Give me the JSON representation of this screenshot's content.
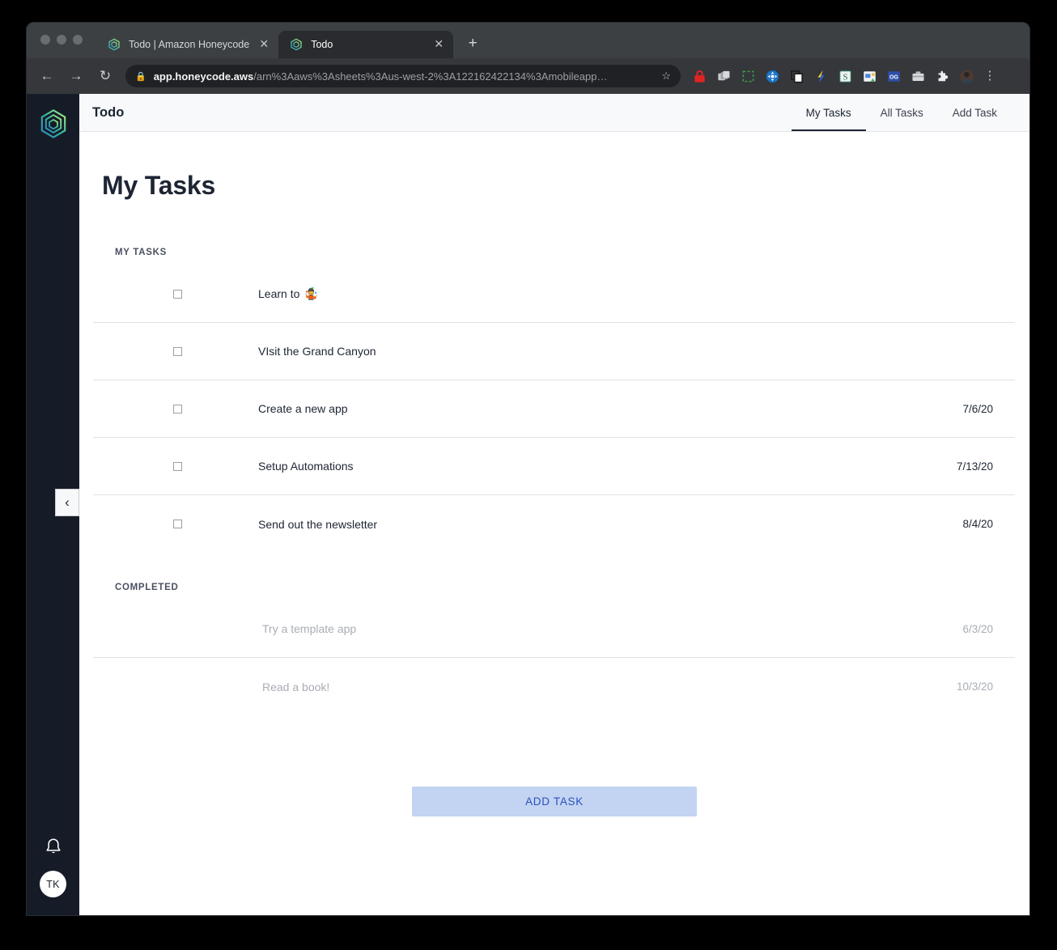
{
  "browser": {
    "tabs": [
      {
        "title": "Todo | Amazon Honeycode",
        "active": false,
        "favicon": "honeycode-icon",
        "close_label": "✕"
      },
      {
        "title": "Todo",
        "active": true,
        "favicon": "honeycode-icon",
        "close_label": "✕"
      }
    ],
    "new_tab_label": "+",
    "nav": {
      "back": "←",
      "forward": "→",
      "reload": "↻"
    },
    "omnibox": {
      "lock": "🔒",
      "url_domain": "app.honeycode.aws",
      "url_path": "/arn%3Aaws%3Asheets%3Aus-west-2%3A122162422134%3Amobileapp…",
      "bookmark_star": "☆"
    },
    "extensions": [
      "padlock-icon",
      "cards-stack-icon",
      "screenshot-select-icon",
      "blue-move-icon",
      "copy-icon",
      "lightning-bolt-icon",
      "s-square-icon",
      "window-photos-icon",
      "og-badge-icon",
      "toolbox-icon",
      "puzzle-piece-icon",
      "profile-avatar-icon"
    ],
    "menu_dots": "⋮"
  },
  "sidebar": {
    "logo": "honeycode-logo",
    "collapse_label": "‹",
    "notifications_icon": "bell-icon",
    "avatar_initials": "TK"
  },
  "app": {
    "name": "Todo",
    "nav_tabs": [
      {
        "label": "My Tasks",
        "active": true
      },
      {
        "label": "All Tasks",
        "active": false
      },
      {
        "label": "Add Task",
        "active": false
      }
    ],
    "page_title": "My Tasks",
    "sections": [
      {
        "label": "MY TASKS",
        "completed": false,
        "tasks": [
          {
            "name": "Learn to",
            "emoji": "🤹",
            "date": ""
          },
          {
            "name": "VIsit the Grand Canyon",
            "emoji": "",
            "date": ""
          },
          {
            "name": "Create a new app",
            "emoji": "",
            "date": "7/6/20"
          },
          {
            "name": "Setup Automations",
            "emoji": "",
            "date": "7/13/20"
          },
          {
            "name": "Send out the newsletter",
            "emoji": "",
            "date": "8/4/20"
          }
        ]
      },
      {
        "label": "COMPLETED",
        "completed": true,
        "tasks": [
          {
            "name": "Try a template app",
            "emoji": "",
            "date": "6/3/20"
          },
          {
            "name": "Read a book!",
            "emoji": "",
            "date": "10/3/20"
          }
        ]
      }
    ],
    "add_task_button": "ADD TASK"
  },
  "colors": {
    "sidebar_bg": "#161c27",
    "accent_button_bg": "#c3d4f2",
    "accent_button_text": "#2a4fbd",
    "text_primary": "#1d2533",
    "text_muted": "#a9adb4"
  }
}
